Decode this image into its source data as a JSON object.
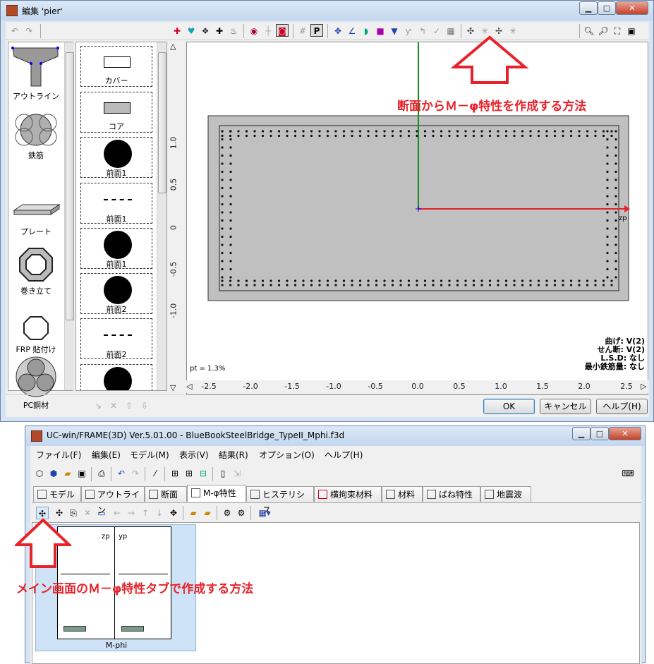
{
  "colors": {
    "annotation_red": "#e8222a",
    "axis_green": "#1a8a1a",
    "section_gray": "#c0c0c0",
    "dialog_frame": "#d6e3f2"
  },
  "dialog": {
    "title": "編集 'pier'",
    "palette_left": {
      "items": [
        {
          "label": "アウトライン",
          "icon": "outline-shape-icon"
        },
        {
          "label": "鉄筋",
          "icon": "rebar-circles-icon"
        },
        {
          "label": "プレート",
          "icon": "plate-icon"
        },
        {
          "label": "巻き立て",
          "icon": "jacket-octagon-icon"
        },
        {
          "label": "FRP 貼付け",
          "icon": "frp-octagon-icon"
        },
        {
          "label": "PC鋼材",
          "icon": "pc-strand-icon"
        }
      ]
    },
    "palette_right": {
      "items": [
        {
          "label": "カバー",
          "icon": "cover-rect-icon"
        },
        {
          "label": "コア",
          "icon": "core-rect-icon"
        },
        {
          "label": "前面1",
          "icon": "filled-circle-icon"
        },
        {
          "label": "前面1",
          "icon": "dashed-line-icon"
        },
        {
          "label": "前面1",
          "icon": "filled-circle-icon"
        },
        {
          "label": "前面2",
          "icon": "filled-circle-icon"
        },
        {
          "label": "前面2",
          "icon": "dashed-line-icon"
        },
        {
          "label": "",
          "icon": "filled-circle-icon"
        }
      ]
    },
    "canvas": {
      "axis_label": "zp",
      "pt_text": "pt = 1.3%",
      "info": [
        "曲げ: V(2)",
        "せん断: V(2)",
        "L.S.D: なし",
        "最小鉄筋量: なし"
      ],
      "y_ticks": [
        "1.0",
        "0.5",
        "0",
        "-0.5",
        "-1.0"
      ],
      "x_ticks": [
        "-2.5",
        "-2.0",
        "-1.5",
        "-1.0",
        "-0.5",
        "0.0",
        "0.5",
        "1.0",
        "1.5",
        "2.0",
        "2.5"
      ]
    },
    "annotation": "断面からＭ－φ特性を作成する方法",
    "buttons": {
      "ok": "OK",
      "cancel": "キャンセル",
      "help": "ヘルプ(H)"
    }
  },
  "main": {
    "title": "UC-win/FRAME(3D) Ver.5.01.00 - BlueBookSteelBridge_TypeII_Mphi.f3d",
    "menu": [
      "ファイル(F)",
      "編集(E)",
      "モデル(M)",
      "表示(V)",
      "結果(R)",
      "オプション(O)",
      "ヘルプ(H)"
    ],
    "tabs": [
      "モデル",
      "アウトライン",
      "断面",
      "M-φ特性",
      "ヒステリシス",
      "横拘束材料",
      "材料",
      "ばね特性",
      "地震波"
    ],
    "card": {
      "axis1": "zp",
      "axis2": "yp",
      "caption": "M-phi"
    },
    "annotation": "メイン画面のＭ－φ特性タブで作成する方法"
  }
}
